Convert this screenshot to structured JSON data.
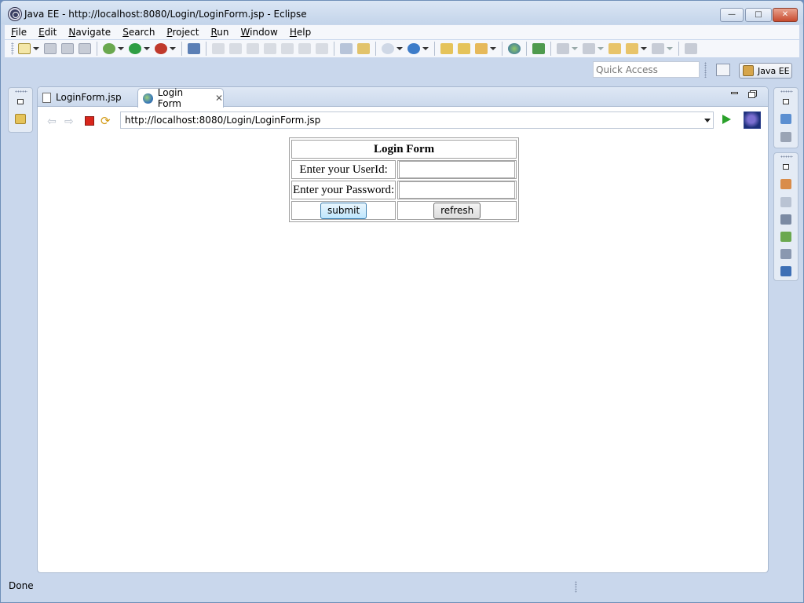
{
  "window": {
    "title": "Java EE - http://localhost:8080/Login/LoginForm.jsp - Eclipse",
    "buttons": {
      "minimize": "—",
      "maximize": "□",
      "close": "✕"
    }
  },
  "menu": [
    {
      "mnemonic": "F",
      "rest": "ile"
    },
    {
      "mnemonic": "E",
      "rest": "dit"
    },
    {
      "mnemonic": "N",
      "rest": "avigate"
    },
    {
      "mnemonic": "S",
      "rest": "earch"
    },
    {
      "mnemonic": "P",
      "rest": "roject"
    },
    {
      "mnemonic": "R",
      "rest": "un"
    },
    {
      "mnemonic": "W",
      "rest": "indow"
    },
    {
      "mnemonic": "H",
      "rest": "elp"
    }
  ],
  "quick_access": {
    "placeholder": "Quick Access"
  },
  "perspective": {
    "label": "Java EE"
  },
  "editor": {
    "tabs": [
      {
        "label": "LoginForm.jsp",
        "icon": "jsp-file-icon",
        "active": false
      },
      {
        "label": "Login Form",
        "icon": "globe-icon",
        "active": true,
        "close": "✕"
      }
    ]
  },
  "browser": {
    "url": "http://localhost:8080/Login/LoginForm.jsp",
    "nav": {
      "back": "⇦",
      "forward": "⇨",
      "refresh": "⟳"
    }
  },
  "login_form": {
    "heading": "Login Form",
    "userid_label": "Enter your UserId:",
    "userid_value": "",
    "password_label": "Enter your Password:",
    "password_value": "",
    "submit_label": "submit",
    "refresh_label": "refresh"
  },
  "status": {
    "text": "Done"
  },
  "colors": {
    "window_frame": "#c9d7ec",
    "stop_red": "#d9261c",
    "go_green": "#2aa12a"
  }
}
